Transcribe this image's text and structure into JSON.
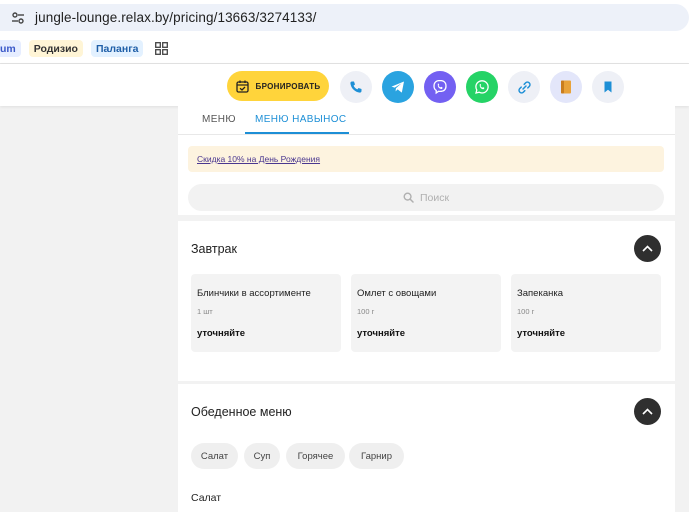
{
  "browser": {
    "url": "jungle-lounge.relax.by/pricing/13663/3274133/",
    "bookmarks": [
      "um",
      "Родизио",
      "Паланга"
    ]
  },
  "topbar": {
    "book_label": "БРОНИРОВАТЬ",
    "icons": [
      "phone-icon",
      "telegram-icon",
      "viber-icon",
      "whatsapp-icon",
      "link-icon",
      "menu-book-icon",
      "bookmark-icon"
    ],
    "colors": {
      "book": "#ffd43b",
      "telegram": "#2aa3e0",
      "viber": "#7360f2",
      "whatsapp": "#25d366",
      "light": "#eef0f6",
      "accent": "#1d8fd6"
    }
  },
  "tabs": [
    "МЕНЮ",
    "МЕНЮ НАВЫНОС"
  ],
  "promo": "Скидка 10% на День Рождения",
  "search": {
    "placeholder": "Поиск"
  },
  "sections": [
    {
      "title": "Завтрак",
      "items": [
        {
          "name": "Блинчики в ассортименте",
          "weight": "1 шт",
          "price": "уточняйте"
        },
        {
          "name": "Омлет с овощами",
          "weight": "100 г",
          "price": "уточняйте"
        },
        {
          "name": "Запеканка",
          "weight": "100 г",
          "price": "уточняйте"
        }
      ]
    },
    {
      "title": "Обеденное меню",
      "chips": [
        "Салат",
        "Суп",
        "Горячее",
        "Гарнир"
      ],
      "subcategory": "Салат"
    }
  ]
}
